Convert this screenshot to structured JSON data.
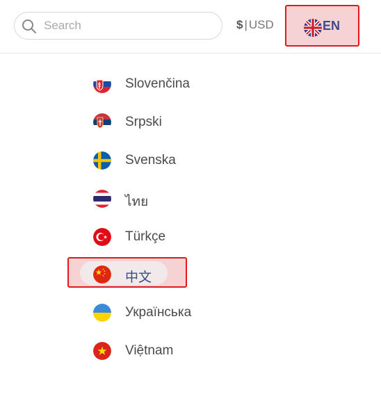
{
  "search": {
    "placeholder": "Search",
    "value": ""
  },
  "currency": {
    "symbol": "$",
    "separator": "|",
    "code": "USD"
  },
  "language_button": {
    "code": "EN",
    "flag_icon": "uk-flag-icon"
  },
  "languages": [
    {
      "label": "Slovenčina",
      "flag_icon": "slovakia-flag-icon"
    },
    {
      "label": "Srpski",
      "flag_icon": "serbia-flag-icon"
    },
    {
      "label": "Svenska",
      "flag_icon": "sweden-flag-icon"
    },
    {
      "label": "ไทย",
      "flag_icon": "thailand-flag-icon"
    },
    {
      "label": "Türkçe",
      "flag_icon": "turkey-flag-icon"
    },
    {
      "label": "中文",
      "flag_icon": "china-flag-icon",
      "selected": true
    },
    {
      "label": "Українська",
      "flag_icon": "ukraine-flag-icon"
    },
    {
      "label": "Việtnam",
      "flag_icon": "vietnam-flag-icon"
    }
  ],
  "colors": {
    "highlight_border": "#e0191f",
    "highlight_fill": "#f7d2d5",
    "accent_text": "#3b4a8a"
  }
}
